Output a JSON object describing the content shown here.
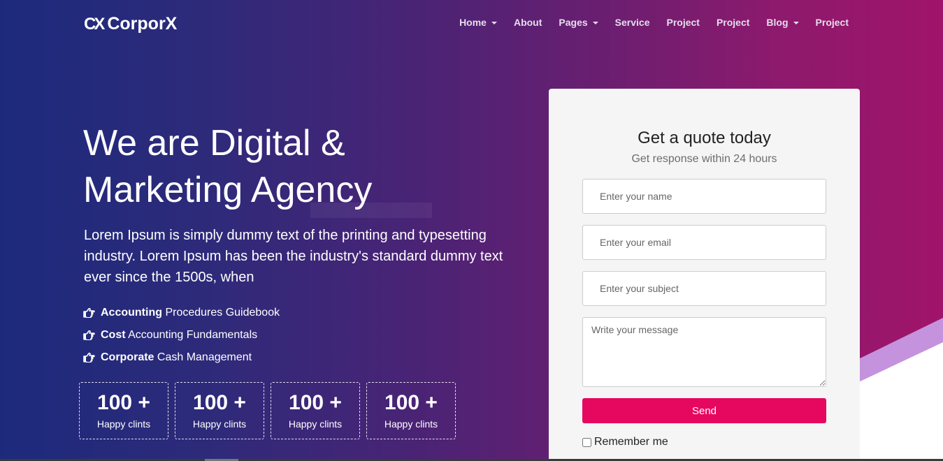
{
  "header": {
    "logo_mark": "CX",
    "logo_text": "CorporX",
    "nav": [
      {
        "label": "Home",
        "dropdown": true
      },
      {
        "label": "About",
        "dropdown": false
      },
      {
        "label": "Pages",
        "dropdown": true
      },
      {
        "label": "Service",
        "dropdown": false
      },
      {
        "label": "Project",
        "dropdown": false
      },
      {
        "label": "Project",
        "dropdown": false
      },
      {
        "label": "Blog",
        "dropdown": true
      },
      {
        "label": "Project",
        "dropdown": false
      }
    ]
  },
  "hero": {
    "title_line1": "We are Digital &",
    "title_line2": "Marketing Agency",
    "description": "Lorem Ipsum is simply dummy text of the printing and typesetting industry. Lorem Ipsum has been the industry's standard dummy text ever since the 1500s, when",
    "features": [
      {
        "bold": "Accounting",
        "rest": " Procedures Guidebook",
        "icon": "hand-point-right-icon"
      },
      {
        "bold": "Cost",
        "rest": " Accounting Fundamentals",
        "icon": "hand-point-right-icon"
      },
      {
        "bold": "Corporate",
        "rest": " Cash Management",
        "icon": "hand-point-right-icon"
      }
    ],
    "stats": [
      {
        "value": "100 +",
        "label": "Happy clints"
      },
      {
        "value": "100 +",
        "label": "Happy clints"
      },
      {
        "value": "100 +",
        "label": "Happy clints"
      },
      {
        "value": "100 +",
        "label": "Happy clints"
      }
    ]
  },
  "form": {
    "title": "Get a quote today",
    "subtitle": "Get response within 24 hours",
    "name_placeholder": "Enter your name",
    "email_placeholder": "Enter your email",
    "subject_placeholder": "Enter your subject",
    "message_placeholder": "Write your message",
    "send_label": "Send",
    "remember_label": "Remember me"
  },
  "colors": {
    "gradient_start": "#1d2a7c",
    "gradient_end": "#a0146a",
    "accent": "#e6085f",
    "wedge": "#c593dd"
  }
}
